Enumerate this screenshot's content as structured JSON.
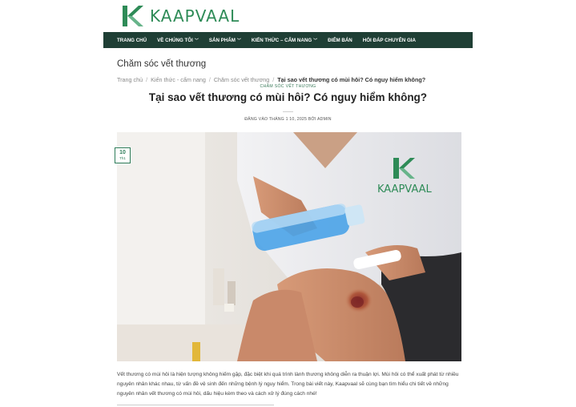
{
  "brand": {
    "name": "KAAPVAAL",
    "name_part1": "KAAP",
    "name_part2": "VAAL",
    "color": "#2e8b57"
  },
  "nav": {
    "background": "#1f3f35",
    "items": [
      {
        "label": "TRANG CHỦ",
        "has_caret": false
      },
      {
        "label": "VỀ CHÚNG TÔI",
        "has_caret": true
      },
      {
        "label": "SẢN PHẨM",
        "has_caret": true
      },
      {
        "label": "KIẾN THỨC – CẨM NANG",
        "has_caret": true
      },
      {
        "label": "ĐIỂM BÁN",
        "has_caret": false
      },
      {
        "label": "HỎI ĐÁP CHUYÊN GIA",
        "has_caret": false
      }
    ]
  },
  "section": {
    "title": "Chăm sóc vết thương"
  },
  "breadcrumb": {
    "items": [
      "Trang chủ",
      "Kiến thức - cẩm nang",
      "Chăm sóc vết thương"
    ],
    "current": "Tại sao vết thương có mùi hôi? Có nguy hiểm không?",
    "separator": "/"
  },
  "article": {
    "category": "CHĂM SÓC VẾT THƯƠNG",
    "title": "Tại sao vết thương có mùi hôi? Có nguy hiểm không?",
    "meta": "ĐĂNG VÀO THÁNG 1 10, 2025 BỞI ADMIN",
    "date_badge": {
      "day": "10",
      "month": "Th1"
    },
    "intro": "Vết thương có mùi hôi là hiện tượng không hiếm gặp, đặc biệt khi quá trình lành thương không diễn ra thuận lợi. Mùi hôi có thể xuất phát từ nhiều nguyên nhân khác nhau, từ vấn đề vệ sinh đến những bệnh lý nguy hiểm. Trong bài viết này, Kaapvaal sẽ cùng bạn tìm hiểu chi tiết về những nguyên nhân vết thương có mùi hôi, dấu hiệu kèm theo và cách xử lý đúng cách nhé!"
  },
  "hero_image": {
    "shirt_logo": "KAAPVAAL",
    "caret_icon": "chevron-down-icon"
  }
}
